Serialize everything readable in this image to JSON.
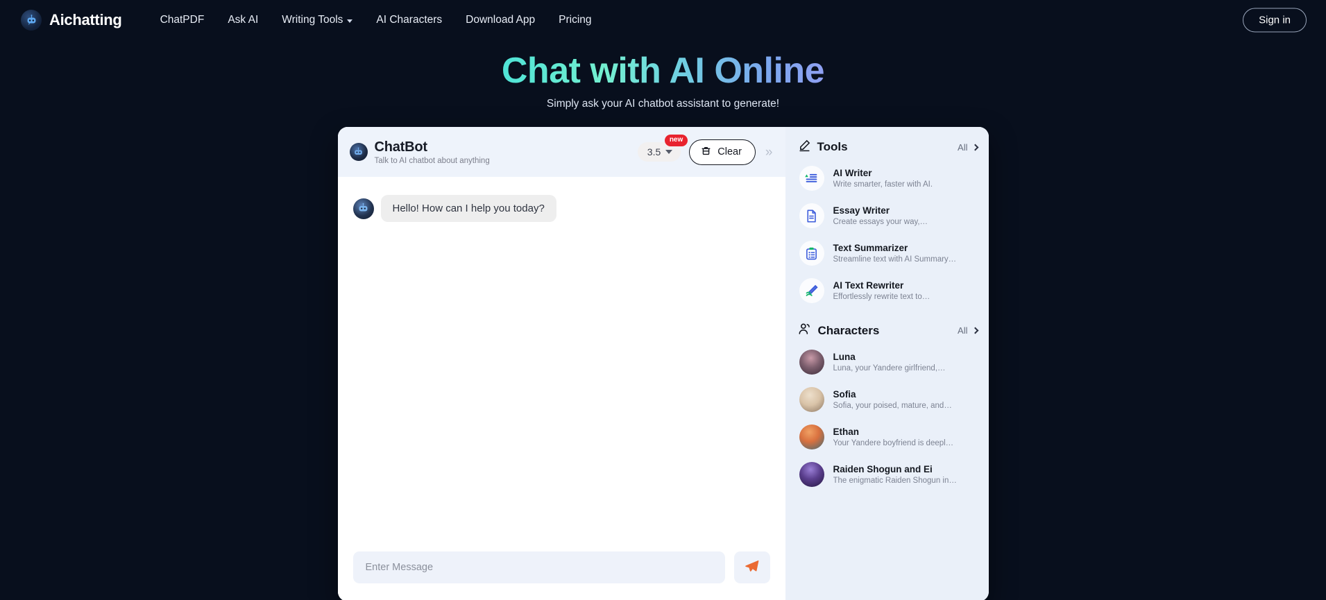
{
  "navbar": {
    "brand": "Aichatting",
    "brand_icon": "chatbot-logo-icon",
    "links": [
      {
        "label": "ChatPDF",
        "has_caret": false
      },
      {
        "label": "Ask AI",
        "has_caret": false
      },
      {
        "label": "Writing Tools",
        "has_caret": true
      },
      {
        "label": "AI Characters",
        "has_caret": false
      },
      {
        "label": "Download App",
        "has_caret": false
      },
      {
        "label": "Pricing",
        "has_caret": false
      }
    ],
    "signin_label": "Sign in"
  },
  "hero": {
    "title": "Chat with AI Online",
    "subtitle": "Simply ask your AI chatbot assistant to generate!",
    "gradient_from": "#4fe3d6",
    "gradient_to": "#8fa0f2"
  },
  "chat": {
    "title": "ChatBot",
    "subtitle": "Talk to AI chatbot about anything",
    "model": "3.5",
    "new_badge": "new",
    "clear_label": "Clear",
    "clear_icon": "trash-icon",
    "collapse_icon": "double-chevron-right-icon",
    "messages": [
      {
        "sender": "bot",
        "text": "Hello! How can I help you today?"
      }
    ],
    "input_placeholder": "Enter Message",
    "input_value": "",
    "send_icon": "paper-plane-icon",
    "send_icon_color": "#ea6a33"
  },
  "sidebar": {
    "tools_section": {
      "title": "Tools",
      "icon": "pencil-edit-icon",
      "all_label": "All",
      "items": [
        {
          "title": "AI Writer",
          "desc": "Write smarter, faster with AI.",
          "icon": "ai-writer-icon"
        },
        {
          "title": "Essay Writer",
          "desc": "Create essays your way,…",
          "icon": "document-icon"
        },
        {
          "title": "Text Summarizer",
          "desc": "Streamline text with AI Summary…",
          "icon": "clipboard-list-icon"
        },
        {
          "title": "AI Text Rewriter",
          "desc": "Effortlessly rewrite text to…",
          "icon": "pen-rewrite-icon"
        }
      ]
    },
    "characters_section": {
      "title": "Characters",
      "icon": "people-icon",
      "all_label": "All",
      "items": [
        {
          "name": "Luna",
          "desc": "Luna, your Yandere girlfriend,…",
          "avatar_colors": [
            "#7d5f6e",
            "#3a2b38"
          ]
        },
        {
          "name": "Sofia",
          "desc": "Sofia, your poised, mature, and…",
          "avatar_colors": [
            "#d9c3a8",
            "#8a7561"
          ]
        },
        {
          "name": "Ethan",
          "desc": "Your Yandere boyfriend is deepl…",
          "avatar_colors": [
            "#e0804f",
            "#4a6f78"
          ]
        },
        {
          "name": "Raiden Shogun and Ei",
          "desc": "The enigmatic Raiden Shogun in…",
          "avatar_colors": [
            "#5b3f8e",
            "#241640"
          ]
        }
      ]
    }
  }
}
